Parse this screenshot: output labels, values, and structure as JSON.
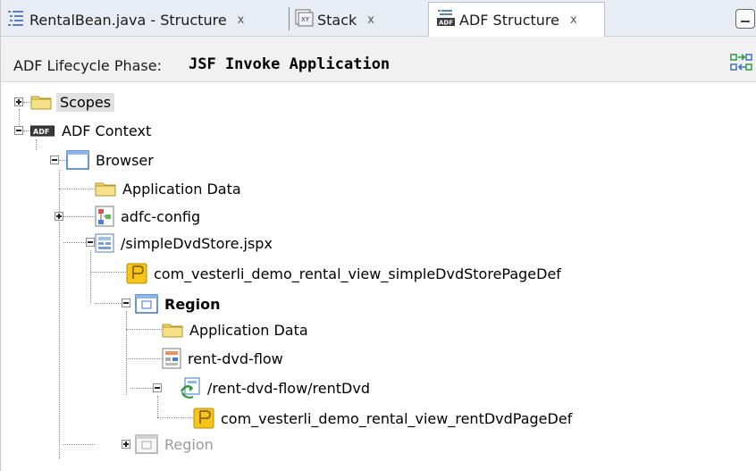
{
  "tabs": [
    {
      "label": "RentalBean.java - Structure",
      "icon": "structure-icon",
      "close": "x",
      "active": false
    },
    {
      "label": "Stack",
      "icon": "stack-icon",
      "close": "x",
      "active": false
    },
    {
      "label": "ADF Structure",
      "icon": "adf-structure-icon",
      "close": "x",
      "active": true
    }
  ],
  "header": {
    "phase_label": "ADF Lifecycle Phase:",
    "phase_value": "JSF Invoke Application"
  },
  "tree": {
    "scopes": "Scopes",
    "adf_context": "ADF Context",
    "browser": "Browser",
    "application_data": "Application Data",
    "adfc_config": "adfc-config",
    "page": "/simpleDvdStore.jspx",
    "page_def": "com_vesterli_demo_rental_view_simpleDvdStorePageDef",
    "region": "Region",
    "region_application_data": "Application Data",
    "task_flow": "rent-dvd-flow",
    "task_flow_activity": "/rent-dvd-flow/rentDvd",
    "activity_page_def": "com_vesterli_demo_rental_view_rentDvdPageDef",
    "region_inactive": "Region"
  },
  "colors": {
    "tabbar_bg": "#e8edf4",
    "header_bg": "#f1f1f1",
    "folder_yellow": "#f3d66b",
    "selection_bg": "#e1e1e1",
    "inactive_text": "#9a9a9a"
  }
}
